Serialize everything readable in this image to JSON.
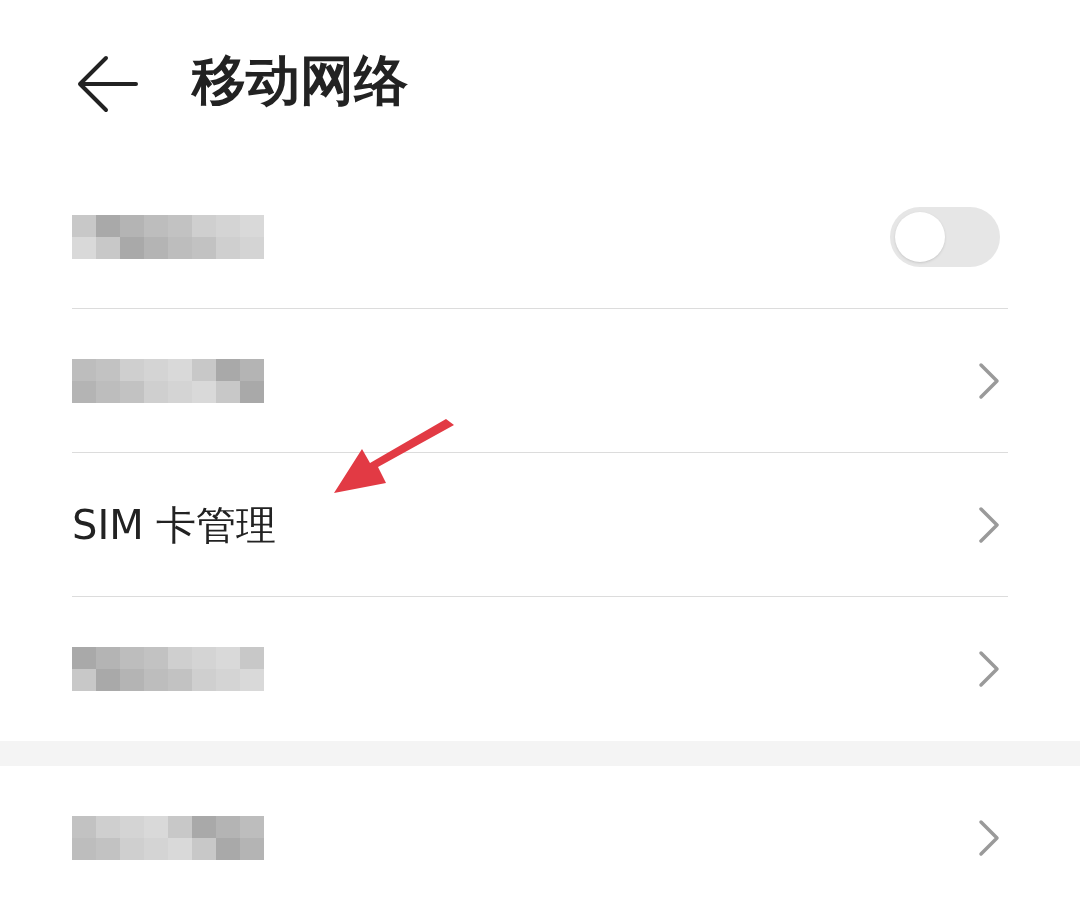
{
  "header": {
    "title": "移动网络"
  },
  "sections": [
    {
      "rows": [
        {
          "kind": "toggle",
          "redacted": true,
          "on": false
        },
        {
          "kind": "link",
          "redacted": true
        },
        {
          "kind": "link",
          "redacted": false,
          "label": "SIM 卡管理",
          "annotated": true
        },
        {
          "kind": "link",
          "redacted": true
        }
      ]
    },
    {
      "rows": [
        {
          "kind": "link",
          "redacted": true
        }
      ]
    }
  ]
}
